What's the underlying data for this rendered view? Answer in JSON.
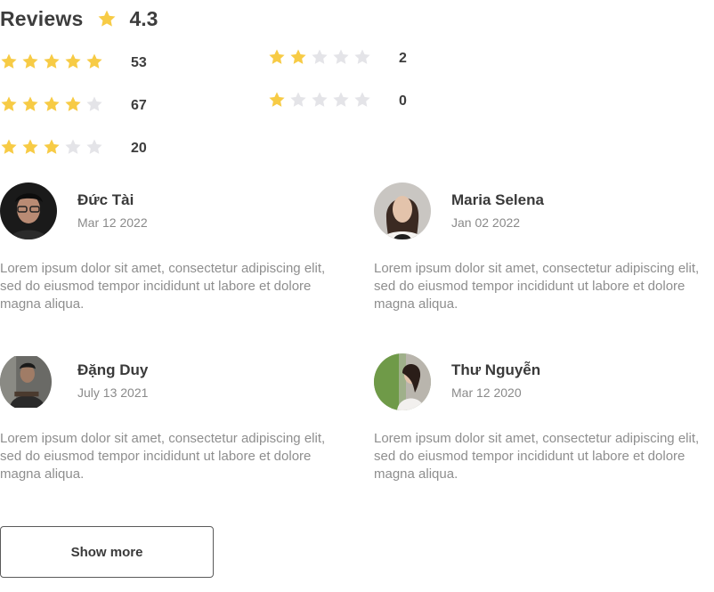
{
  "header": {
    "title": "Reviews",
    "rating": "4.3",
    "star_icon": "star-icon"
  },
  "distribution": [
    {
      "stars": 5,
      "count": "53"
    },
    {
      "stars": 4,
      "count": "67"
    },
    {
      "stars": 3,
      "count": "20"
    },
    {
      "stars": 2,
      "count": "2"
    },
    {
      "stars": 1,
      "count": "0"
    }
  ],
  "reviews": [
    {
      "name": "Đức Tài",
      "date": "Mar 12 2022",
      "text": "Lorem ipsum dolor sit amet, consectetur adipiscing elit, sed do eiusmod tempor incididunt ut labore et dolore magna aliqua."
    },
    {
      "name": "Maria Selena",
      "date": "Jan 02 2022",
      "text": "Lorem ipsum dolor sit amet, consectetur adipiscing elit, sed do eiusmod tempor incididunt ut labore et dolore magna aliqua."
    },
    {
      "name": "Đặng Duy",
      "date": "July 13 2021",
      "text": "Lorem ipsum dolor sit amet, consectetur adipiscing elit, sed do eiusmod tempor incididunt ut labore et dolore magna aliqua."
    },
    {
      "name": "Thư Nguyễn",
      "date": "Mar 12 2020",
      "text": "Lorem ipsum dolor sit amet, consectetur adipiscing elit, sed do eiusmod tempor incididunt ut labore et dolore magna aliqua."
    }
  ],
  "show_more_label": "Show more",
  "colors": {
    "star_filled": "#F7CB45",
    "star_empty": "#E4E4E8",
    "text_dark": "#3d3d3d",
    "text_muted": "#8e8e8e"
  }
}
